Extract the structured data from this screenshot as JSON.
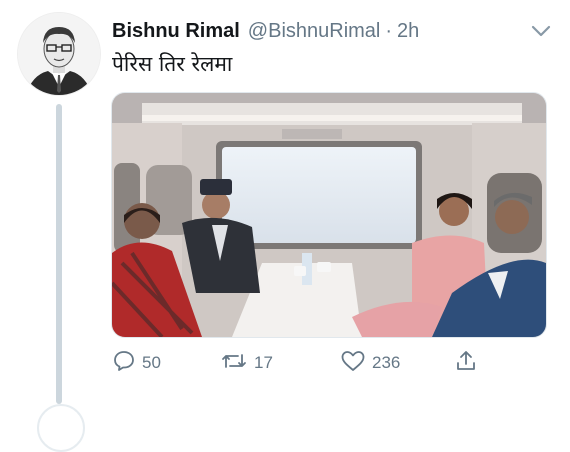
{
  "tweet": {
    "author_name": "Bishnu Rimal",
    "author_handle": "@BishnuRimal",
    "separator": "·",
    "time": "2h",
    "text": "पेरिस तिर रेलमा"
  },
  "actions": {
    "replies": "50",
    "retweets": "17",
    "likes": "236"
  },
  "icons": [
    "chevron-down-icon",
    "reply-icon",
    "retweet-icon",
    "like-icon",
    "share-icon"
  ],
  "colors": {
    "text": "#14171a",
    "secondary": "#657786",
    "thread_line": "#ccd6dd"
  }
}
